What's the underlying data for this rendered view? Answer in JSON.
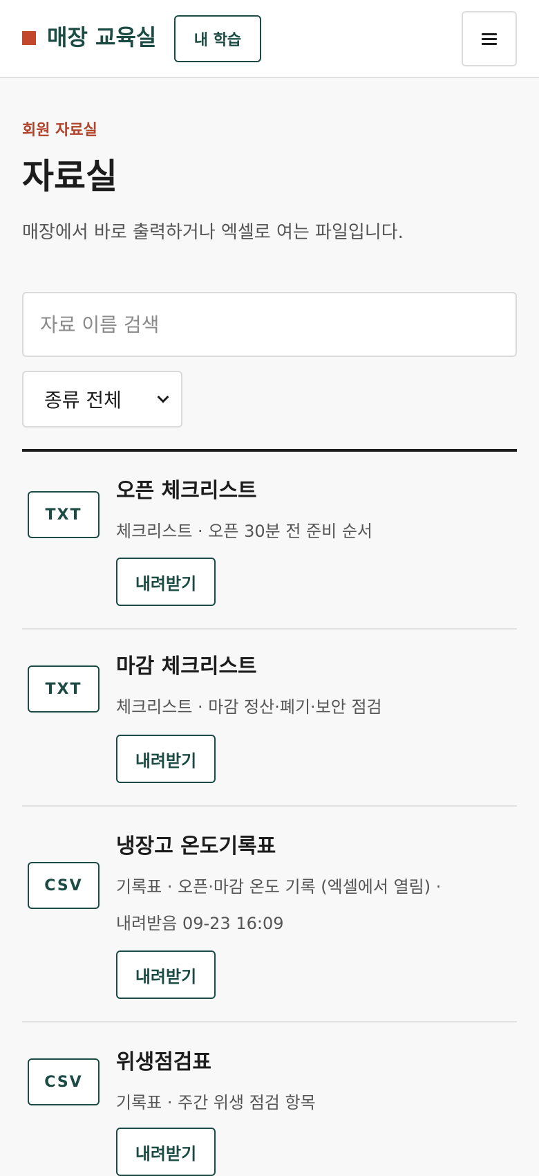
{
  "header": {
    "brand": "매장 교육실",
    "my_learning": "내 학습",
    "menu_icon": "hamburger-icon"
  },
  "intro": {
    "eyebrow": "회원 자료실",
    "title": "자료실",
    "description": "매장에서 바로 출력하거나 엑셀로 여는 파일입니다."
  },
  "filters": {
    "search_placeholder": "자료 이름 검색",
    "search_value": "",
    "type_selected": "종류 전체"
  },
  "colors": {
    "brand": "#1b4b43",
    "accent": "#c2472d"
  },
  "files": [
    {
      "type": "TXT",
      "title": "오픈 체크리스트",
      "meta": "체크리스트 · 오픈 30분 전 준비 순서",
      "download_label": "내려받기"
    },
    {
      "type": "TXT",
      "title": "마감 체크리스트",
      "meta": "체크리스트 · 마감 정산·폐기·보안 점검",
      "download_label": "내려받기"
    },
    {
      "type": "CSV",
      "title": "냉장고 온도기록표",
      "meta": "기록표 · 오픈·마감 온도 기록 (엑셀에서 열림) · 내려받음 09-23 16:09",
      "download_label": "내려받기"
    },
    {
      "type": "CSV",
      "title": "위생점검표",
      "meta": "기록표 · 주간 위생 점검 항목",
      "download_label": "내려받기"
    }
  ]
}
